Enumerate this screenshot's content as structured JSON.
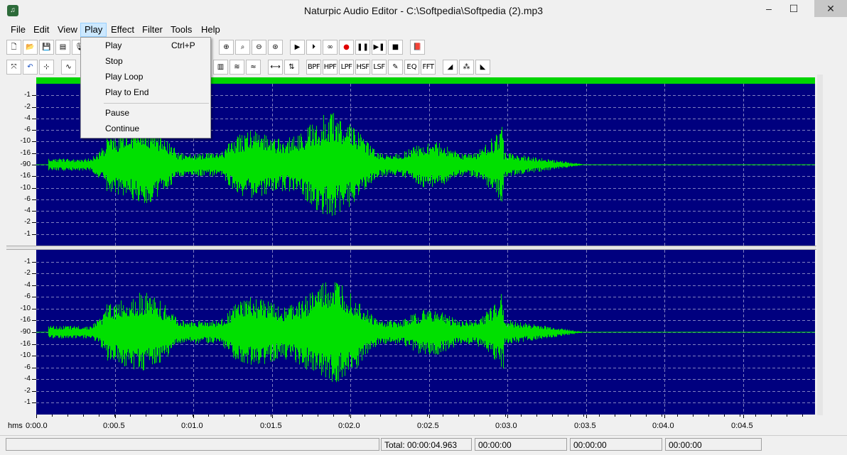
{
  "window": {
    "title": "Naturpic Audio Editor - C:\\Softpedia\\Softpedia (2).mp3",
    "minimize": "–",
    "maximize": "☐",
    "close": "✕"
  },
  "menubar": {
    "items": [
      "File",
      "Edit",
      "View",
      "Play",
      "Effect",
      "Filter",
      "Tools",
      "Help"
    ],
    "active": "Play"
  },
  "play_menu": {
    "items": [
      {
        "label": "Play",
        "shortcut": "Ctrl+P"
      },
      {
        "label": "Stop",
        "shortcut": ""
      },
      {
        "label": "Play Loop",
        "shortcut": ""
      },
      {
        "label": "Play to End",
        "shortcut": ""
      },
      {
        "label": "Pause",
        "shortcut": ""
      },
      {
        "label": "Continue",
        "shortcut": ""
      }
    ]
  },
  "toolbar": {
    "row1_icons": [
      "new-file-icon",
      "open-folder-icon",
      "save-icon",
      "properties-icon",
      "record-icon",
      "zoom-in-icon",
      "zoom-out-icon",
      "zoom-selection-icon",
      "zoom-all-icon",
      "play-icon",
      "play-circle-icon",
      "loop-icon",
      "record-dot-icon",
      "pause-icon",
      "step-icon",
      "stop-icon",
      "book-icon"
    ],
    "row2_text_buttons": [
      "BPF",
      "HPF",
      "LPF",
      "HSF",
      "LSF",
      "FFT"
    ]
  },
  "ruler": {
    "labels": [
      "-1",
      "-2",
      "-4",
      "-6",
      "-10",
      "-16",
      "-90",
      "-16",
      "-10",
      "-6",
      "-4",
      "-2",
      "-1"
    ]
  },
  "timeline": {
    "prefix": "hms",
    "labels": [
      "0:00.0",
      "0:00.5",
      "0:01.0",
      "0:01.5",
      "0:02.0",
      "0:02.5",
      "0:03.0",
      "0:03.5",
      "0:04.0",
      "0:04.5"
    ]
  },
  "status": {
    "total": "Total: 00:00:04.963",
    "cell2": "00:00:00",
    "cell3": "00:00:00",
    "cell4": "00:00:00"
  },
  "colors": {
    "waveform": "#00e000",
    "background": "#00007f",
    "gridline": "#8080c0",
    "top_bar": "#00d400"
  }
}
